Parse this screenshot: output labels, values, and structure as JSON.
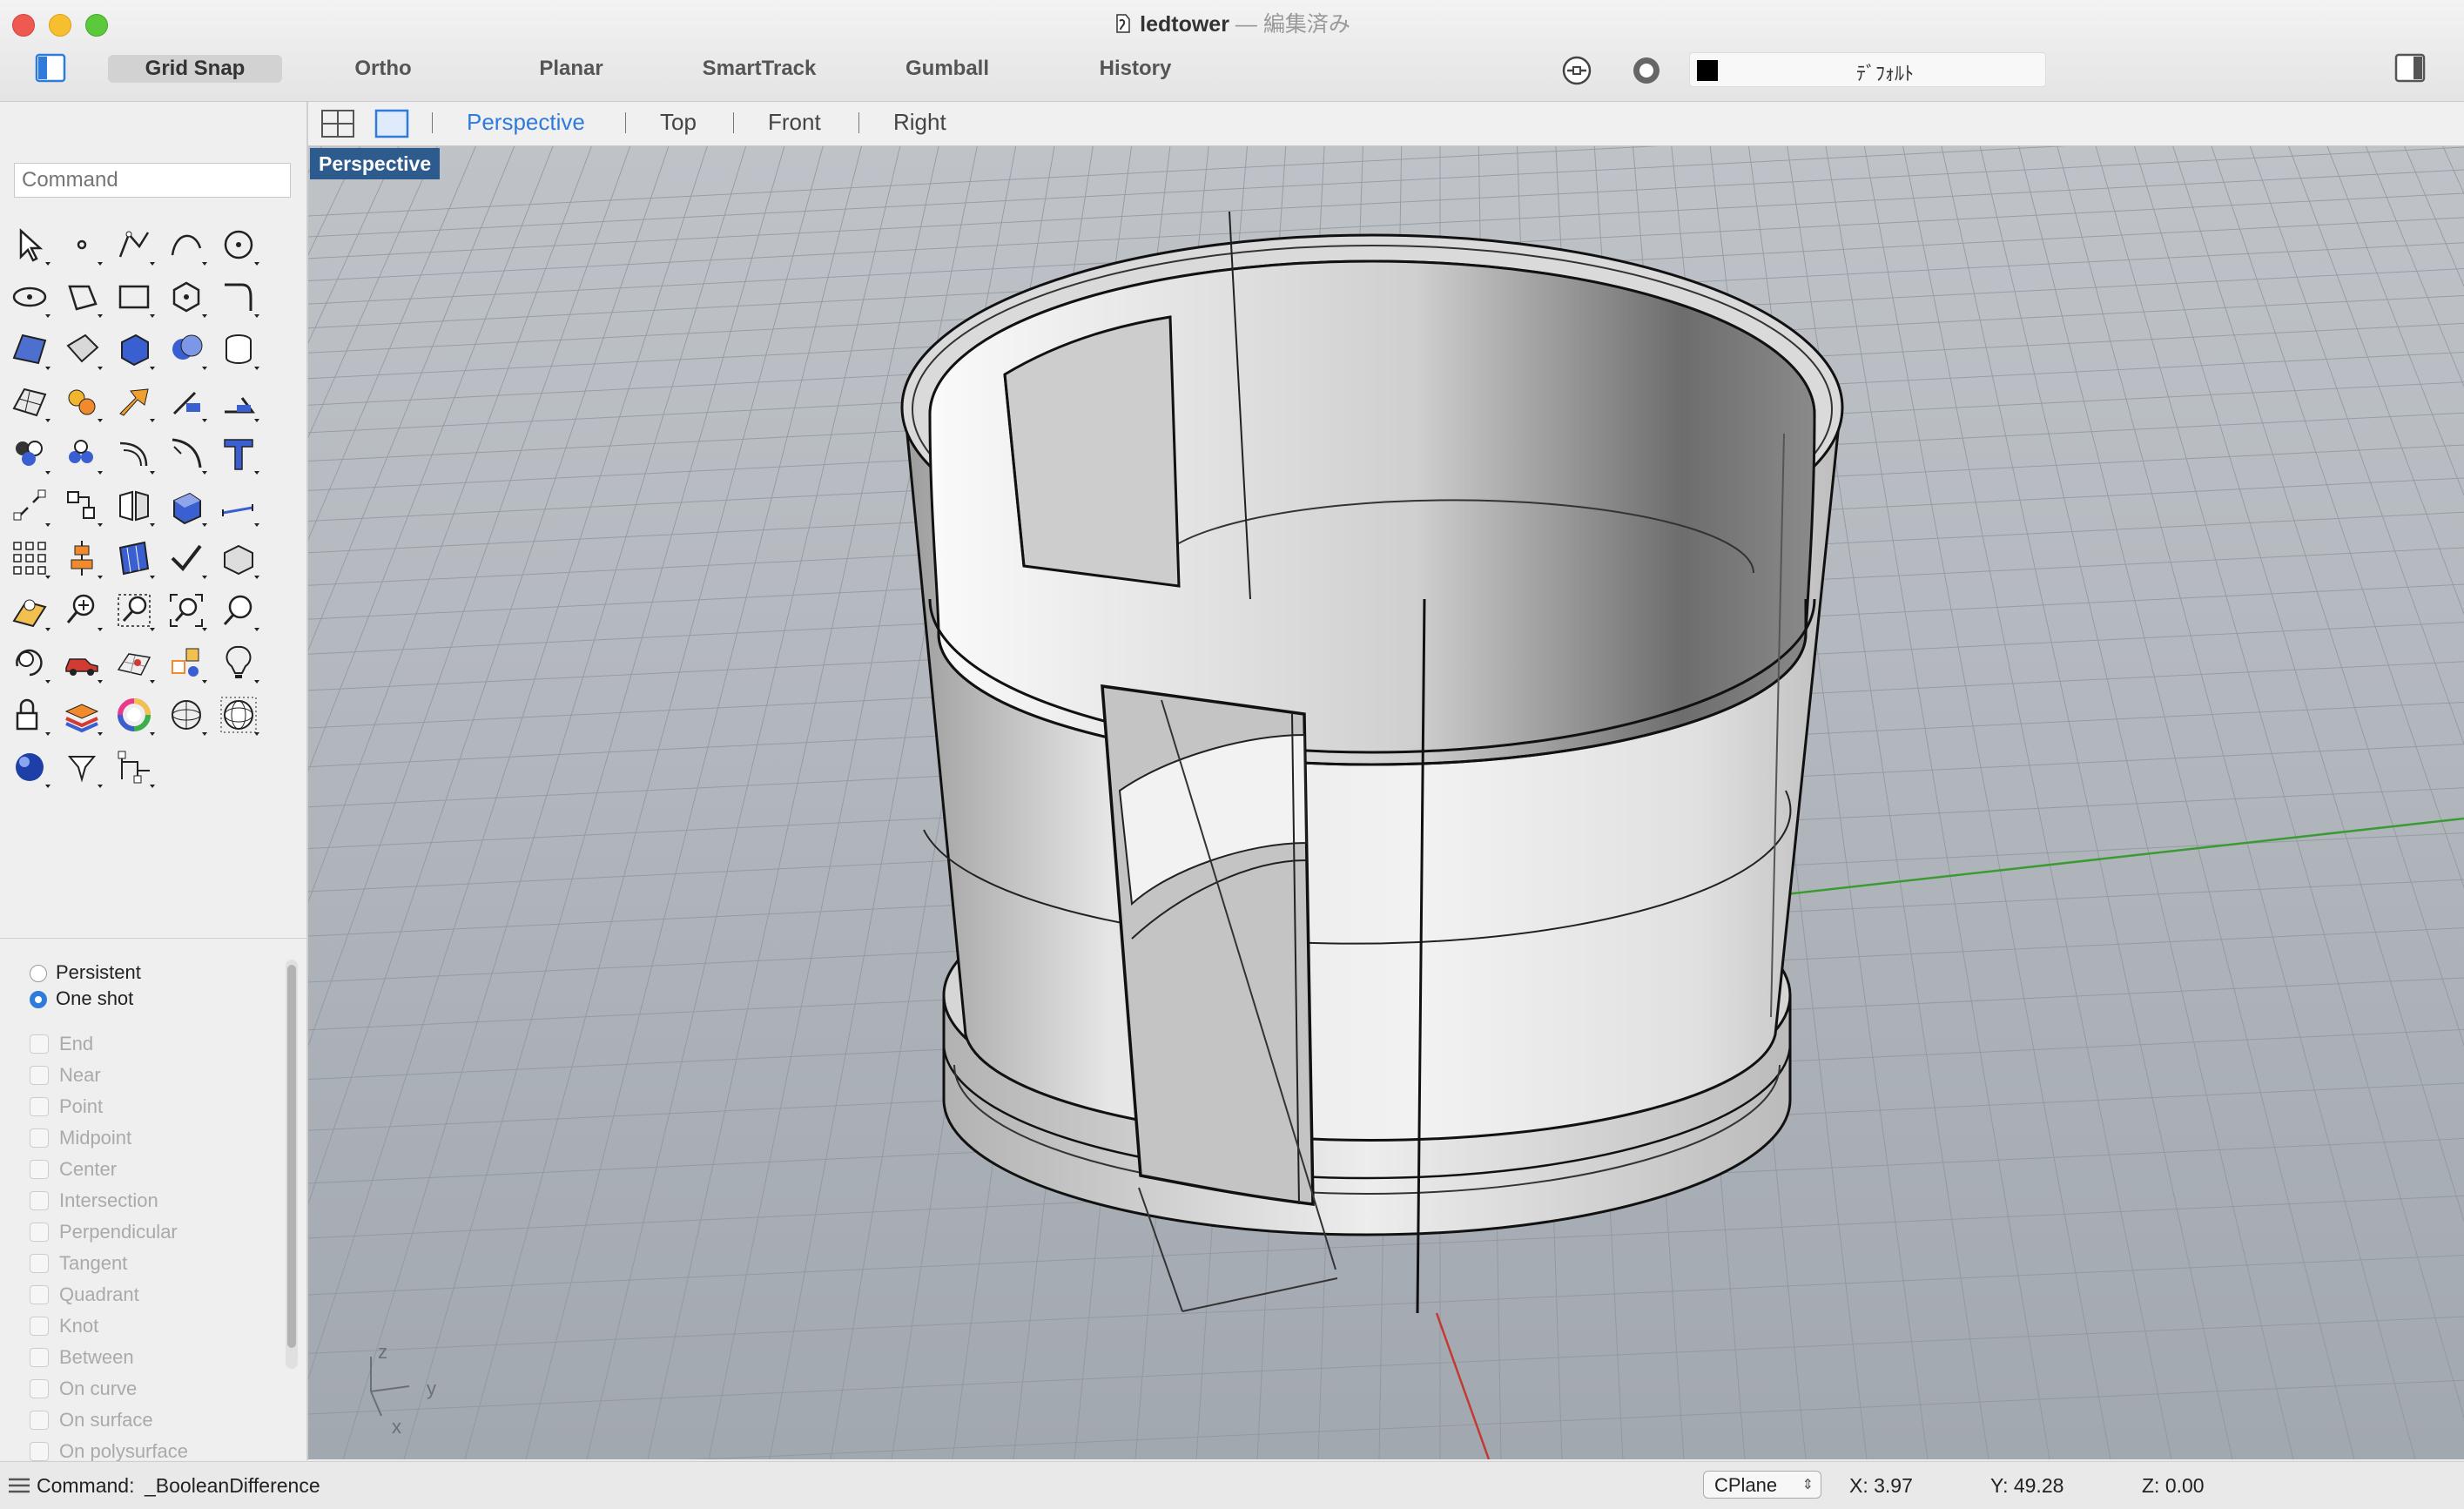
{
  "window": {
    "title": "ledtower",
    "separator": "—",
    "status": "編集済み"
  },
  "toolbar": {
    "grid_snap": "Grid Snap",
    "ortho": "Ortho",
    "planar": "Planar",
    "smarttrack": "SmartTrack",
    "gumball": "Gumball",
    "history": "History",
    "layer_name": "ﾃﾞﾌｫﾙﾄ",
    "layer_color": "#000000"
  },
  "viewport_tabs": {
    "perspective": "Perspective",
    "top": "Top",
    "front": "Front",
    "right": "Right",
    "active": "Perspective"
  },
  "viewport": {
    "label": "Perspective",
    "axis_z": "z",
    "axis_y": "y",
    "axis_x": "x"
  },
  "command": {
    "placeholder": "Command"
  },
  "tool_icons": [
    "select-arrow-icon",
    "point-icon",
    "polyline-icon",
    "curve-icon",
    "circle-icon",
    "ellipse-icon",
    "polygon-icon",
    "rectangle-icon",
    "polygon-center-icon",
    "fillet-curve-icon",
    "surface-icon",
    "loft-icon",
    "box-icon",
    "solid-union-icon",
    "cylinder-icon",
    "mesh-icon",
    "analyze-icon",
    "explode-icon",
    "trim-icon",
    "split-icon",
    "boolean-icon",
    "group-icon",
    "offset-icon",
    "blend-icon",
    "text-icon",
    "move-icon",
    "transform-icon",
    "mirror-icon",
    "extrude-icon",
    "dimension-icon",
    "array-icon",
    "align-icon",
    "section-icon",
    "check-icon",
    "box-edit-icon",
    "pan-icon",
    "zoom-icon",
    "zoom-window-icon",
    "zoom-extents-icon",
    "zoom-selected-icon",
    "rotate-view-icon",
    "car-icon",
    "render-grid-icon",
    "snapshot-icon",
    "light-icon",
    "lock-icon",
    "layer-icon",
    "color-wheel-icon",
    "sphere-wire-icon",
    "sphere-mesh-icon",
    "material-ball-icon",
    "camera-icon",
    "curve-tree-icon"
  ],
  "osnap": {
    "persistent": "Persistent",
    "one_shot": "One shot",
    "items": [
      "End",
      "Near",
      "Point",
      "Midpoint",
      "Center",
      "Intersection",
      "Perpendicular",
      "Tangent",
      "Quadrant",
      "Knot",
      "Between",
      "On curve",
      "On surface",
      "On polysurface"
    ]
  },
  "status": {
    "command_label": "Command:",
    "command_value": "_BooleanDifference",
    "cplane": "CPlane",
    "x": "X: 3.97",
    "y": "Y: 49.28",
    "z": "Z: 0.00"
  }
}
